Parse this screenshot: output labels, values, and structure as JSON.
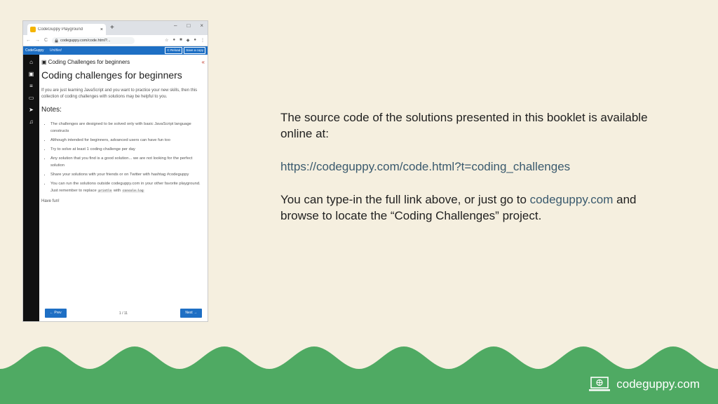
{
  "browser": {
    "tab_title": "CodeGuppy Playground",
    "tab_close": "×",
    "new_tab": "+",
    "window_controls": [
      "–",
      "□",
      "×"
    ],
    "nav": [
      "←",
      "→",
      "C"
    ],
    "url": "codeguppy.com/code.html?...",
    "app": {
      "brand": "CodeGuppy",
      "filename": "Untitled",
      "reload": "C Reload",
      "save": "Save a copy"
    },
    "panel": {
      "header": "Coding Challenges for beginners",
      "collapse": "«",
      "title": "Coding challenges for beginners",
      "intro": "If you are just learning JavaScript and you want to practice your new skills, then this collection of coding challenges with solutions may be helpful to you.",
      "notes_heading": "Notes:",
      "notes": [
        "The challenges are designed to be solved only with basic JavaScript language constructs",
        "Although intended for beginners, advanced users can have fun too",
        "Try to solve at least 1 coding challenge per day",
        "Any solution that you find is a good solution... we are not looking for the perfect solution",
        "Share your solutions with your friends or on Twitter with hashtag #codeguppy"
      ],
      "last_note_before": "You can run the solutions outside codeguppy.com in your other favorite playground. Just remember to replace ",
      "code_println": "println",
      "last_note_mid": " with ",
      "code_console": "console.log",
      "have_fun": "Have fun!",
      "prev": "← Prev",
      "page": "1 / 11",
      "next": "Next →"
    }
  },
  "info": {
    "line1": "The source code of the solutions presented in this booklet is available online at:",
    "url": "https://codeguppy.com/code.html?t=coding_challenges",
    "line2_before": "You can type-in the full link above, or just go to ",
    "line2_link": "codeguppy.com",
    "line2_after": " and browse to locate the “Coding Challenges” project."
  },
  "footer": {
    "brand": "codeguppy.com"
  },
  "colors": {
    "background": "#f5efdf",
    "wave": "#4faa63",
    "accent": "#1e6fc4",
    "link": "#3a5a6e"
  },
  "icons": [
    "home-icon",
    "book-icon",
    "menu-icon",
    "image-icon",
    "rocket-icon",
    "music-icon",
    "laptop-icon"
  ]
}
